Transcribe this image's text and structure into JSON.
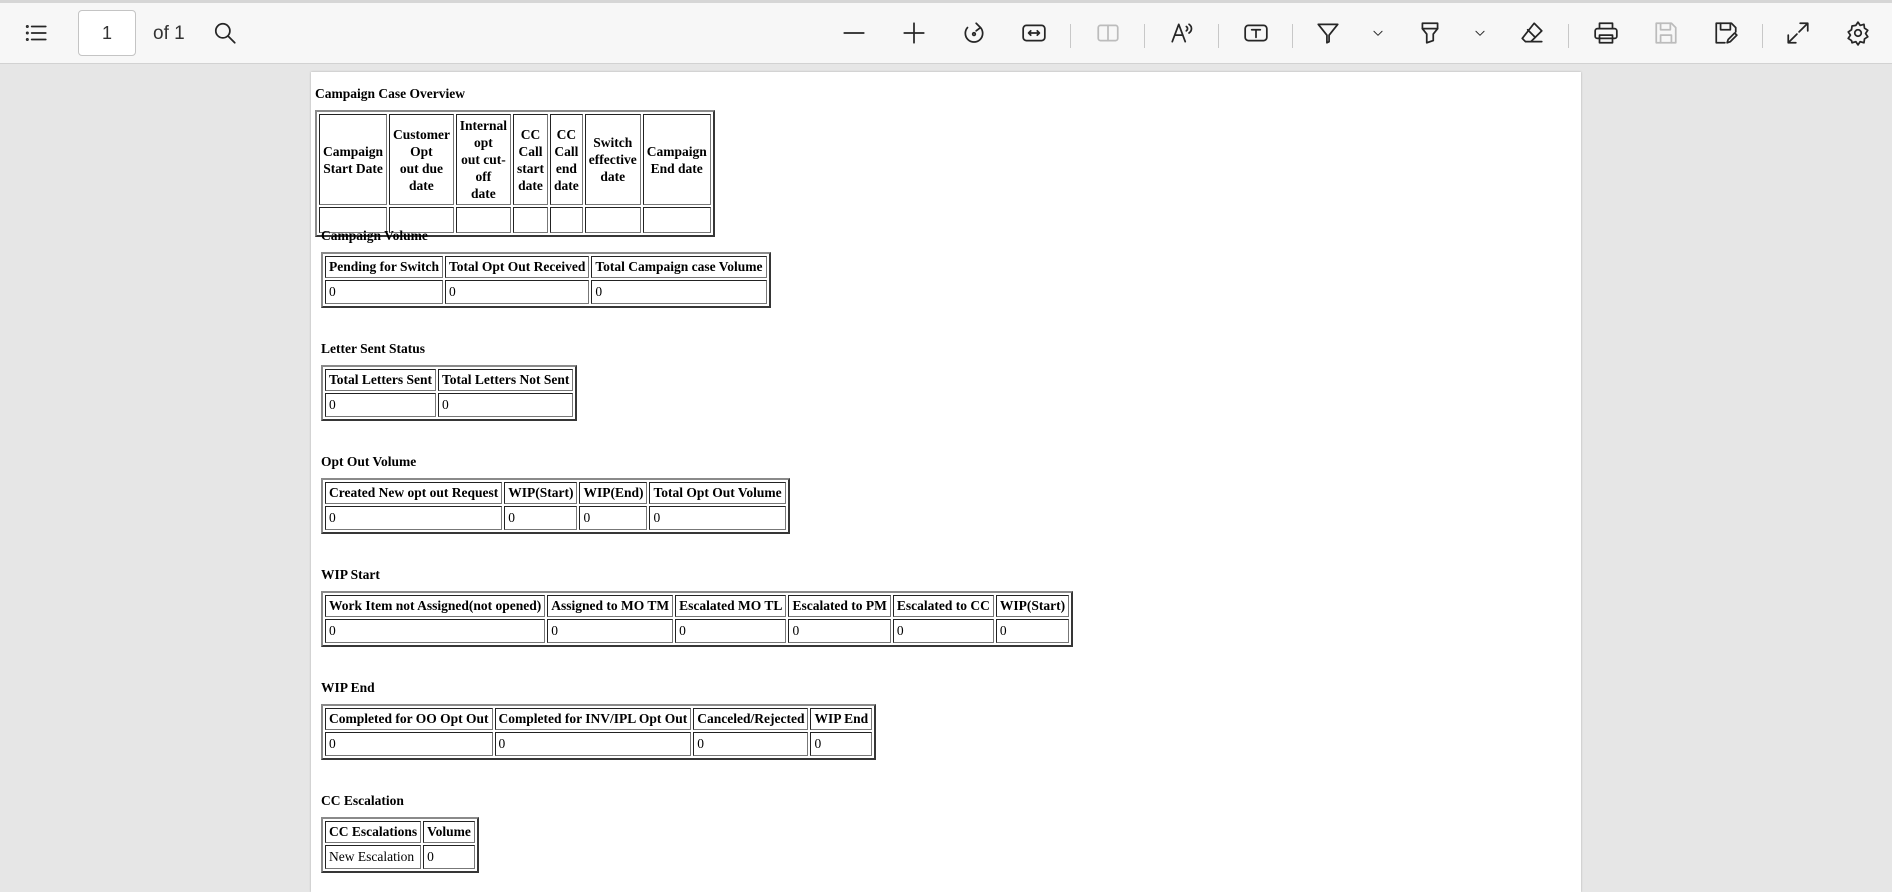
{
  "toolbar": {
    "page_current": "1",
    "page_of": "of 1"
  },
  "overview": {
    "title": "Campaign Case Overview",
    "headers": [
      [
        "Campaign",
        "Start Date"
      ],
      [
        "Customer Opt",
        "out due date"
      ],
      [
        "Internal opt",
        "out cut-off",
        "date"
      ],
      [
        "CC Call",
        "start",
        "date"
      ],
      [
        "CC Call",
        "end",
        "date"
      ],
      [
        "Switch",
        "effective",
        "date"
      ],
      [
        "Campaign",
        "End date"
      ]
    ]
  },
  "campaign_volume": {
    "title": "Campaign Volume",
    "headers": [
      "Pending for Switch",
      "Total Opt Out Received",
      "Total Campaign case Volume"
    ],
    "values": [
      "0",
      "0",
      "0"
    ]
  },
  "letter_status": {
    "title": "Letter Sent Status",
    "headers": [
      "Total Letters Sent",
      "Total Letters Not Sent"
    ],
    "values": [
      "0",
      "0"
    ]
  },
  "opt_out_volume": {
    "title": "Opt Out Volume",
    "headers": [
      "Created New opt out Request",
      "WIP(Start)",
      "WIP(End)",
      "Total Opt Out Volume"
    ],
    "values": [
      "0",
      "0",
      "0",
      "0"
    ]
  },
  "wip_start": {
    "title": "WIP Start",
    "headers": [
      "Work Item not Assigned(not opened)",
      "Assigned to MO TM",
      "Escalated MO TL",
      "Escalated to PM",
      "Escalated to CC",
      "WIP(Start)"
    ],
    "values": [
      "0",
      "0",
      "0",
      "0",
      "0",
      "0"
    ]
  },
  "wip_end": {
    "title": "WIP End",
    "headers": [
      "Completed for OO Opt Out",
      "Completed for INV/IPL Opt Out",
      "Canceled/Rejected",
      "WIP End"
    ],
    "values": [
      "0",
      "0",
      "0",
      "0"
    ]
  },
  "cc_escalation": {
    "title": "CC Escalation",
    "headers": [
      "CC Escalations",
      "Volume"
    ],
    "rows": [
      [
        "New Escalation",
        "0"
      ]
    ]
  }
}
